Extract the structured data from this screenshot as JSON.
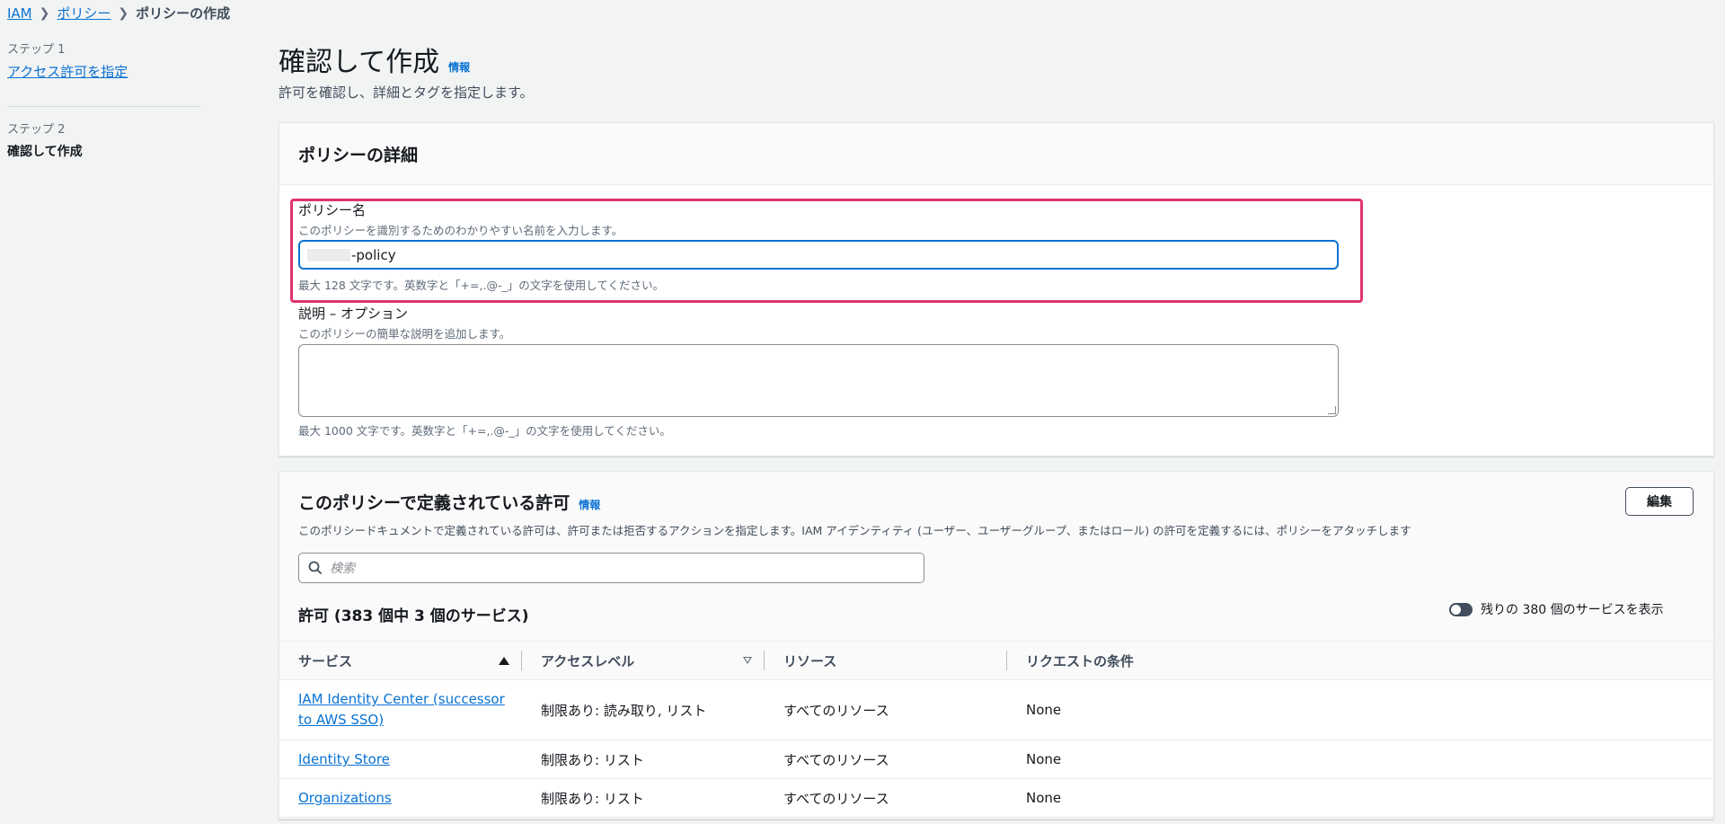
{
  "breadcrumb": {
    "items": [
      "IAM",
      "ポリシー"
    ],
    "current": "ポリシーの作成"
  },
  "sidenav": {
    "step1_label": "ステップ 1",
    "step1_link": "アクセス許可を指定",
    "step2_label": "ステップ 2",
    "step2_current": "確認して作成"
  },
  "header": {
    "title": "確認して作成",
    "info": "情報",
    "description": "許可を確認し、詳細とタグを指定します。"
  },
  "details": {
    "heading": "ポリシーの詳細",
    "name_label": "ポリシー名",
    "name_desc": "このポリシーを識別するためのわかりやすい名前を入力します。",
    "name_value": "-policy",
    "name_constraint": "最大 128 文字です。英数字と「+=,.@-_」の文字を使用してください。",
    "desc_label": "説明 – オプション",
    "desc_desc": "このポリシーの簡単な説明を追加します。",
    "desc_value": "",
    "desc_constraint": "最大 1000 文字です。英数字と「+=,.@-_」の文字を使用してください。"
  },
  "permissions": {
    "heading": "このポリシーで定義されている許可",
    "info": "情報",
    "description": "このポリシードキュメントで定義されている許可は、許可または拒否するアクションを指定します。IAM アイデンティティ (ユーザー、ユーザーグループ、またはロール) の許可を定義するには、ポリシーをアタッチします",
    "edit_label": "編集",
    "search_placeholder": "検索",
    "count_heading": "許可 (383 個中 3 個のサービス)",
    "toggle_label": "残りの 380 個のサービスを表示",
    "columns": [
      "サービス",
      "アクセスレベル",
      "リソース",
      "リクエストの条件"
    ],
    "rows": [
      {
        "service": "IAM Identity Center (successor to AWS SSO)",
        "access": "制限あり: 読み取り, リスト",
        "resource": "すべてのリソース",
        "condition": "None"
      },
      {
        "service": "Identity Store",
        "access": "制限あり: リスト",
        "resource": "すべてのリソース",
        "condition": "None"
      },
      {
        "service": "Organizations",
        "access": "制限あり: リスト",
        "resource": "すべてのリソース",
        "condition": "None"
      }
    ]
  },
  "colors": {
    "link": "#0972d3",
    "highlight": "#e0336e",
    "background": "#f2f3f3"
  }
}
